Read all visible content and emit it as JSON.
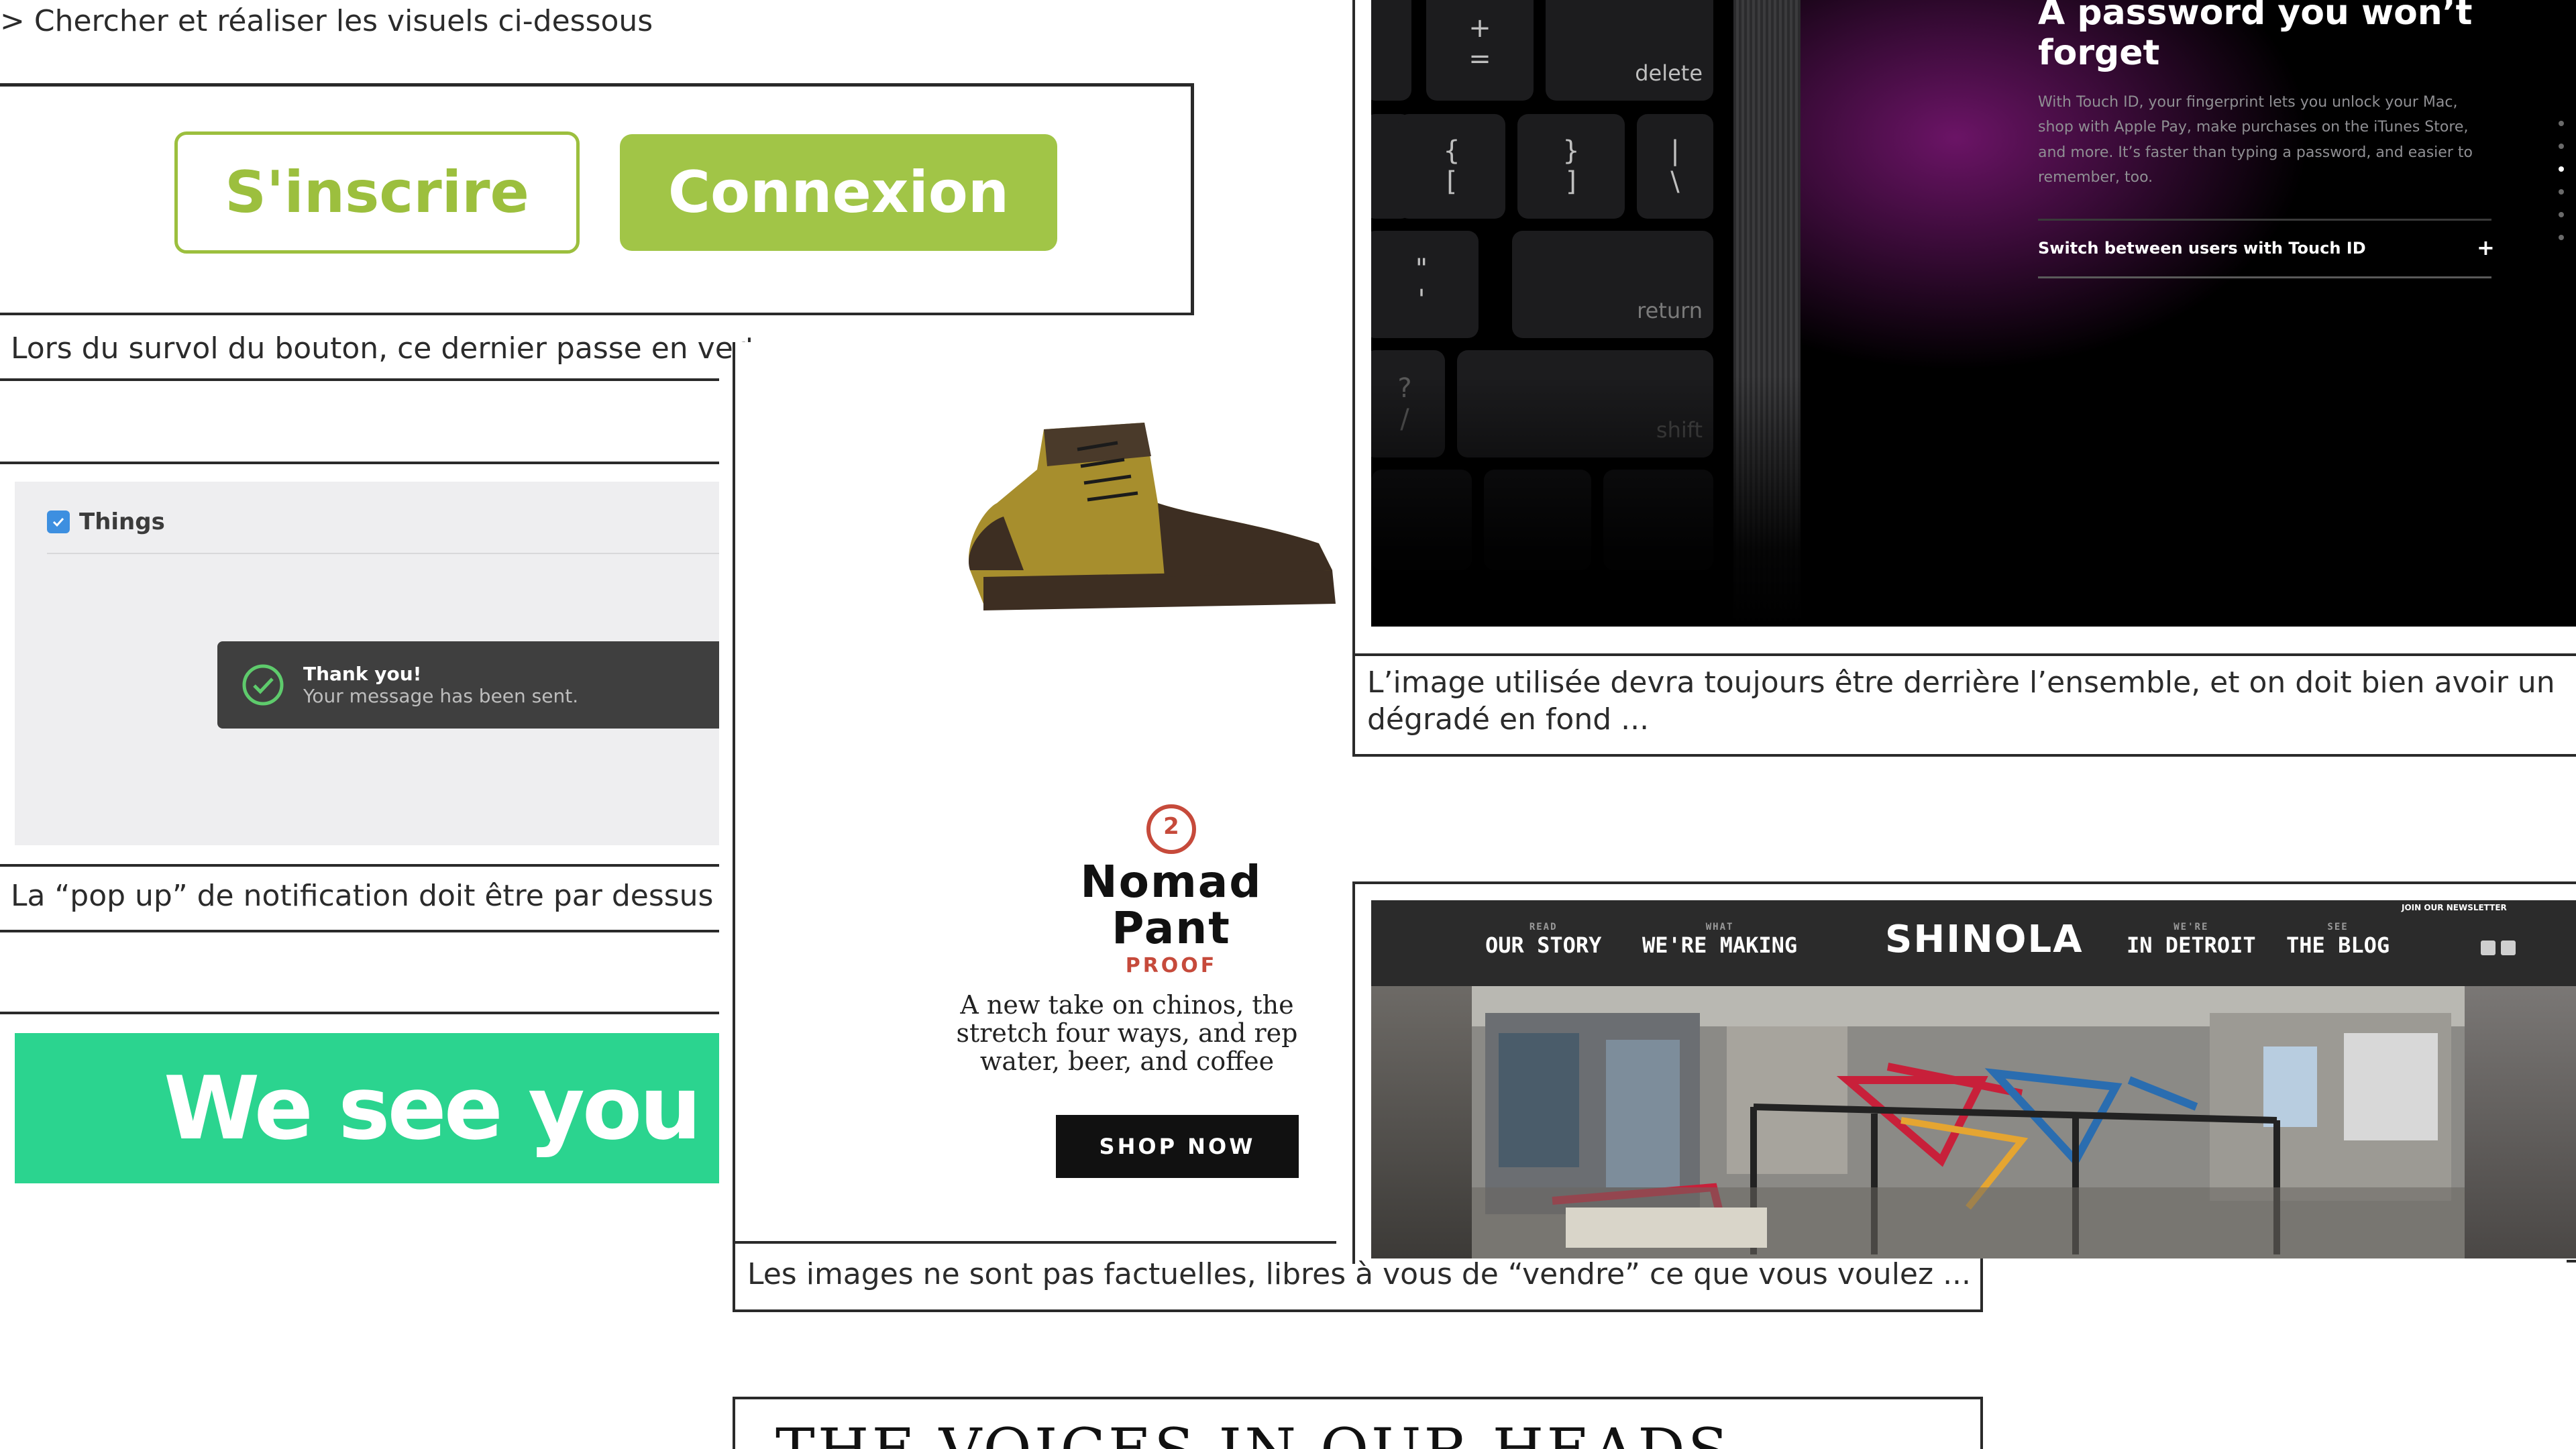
{
  "instruction": "> Chercher et réaliser les visuels ci-dessous",
  "buttons_demo": {
    "signup_label": "S'inscrire",
    "login_label": "Connexion",
    "caption": "Lors du survol du bouton, ce dernier passe en vert."
  },
  "things_demo": {
    "app_name": "Things",
    "toast_title": "Thank you!",
    "toast_message": "Your message has been sent.",
    "caption": "La “pop up” de notification doit être par dessus l’e"
  },
  "green_demo": {
    "text": "We see you th"
  },
  "product_demo": {
    "badge_number": "2",
    "title_line1": "Nomad",
    "title_line2": "Pant",
    "subtitle": "PROOF",
    "desc_line1": "A new take on chinos, the",
    "desc_line2": "stretch four ways, and rep",
    "desc_line3": "water, beer, and coffee",
    "cta": "SHOP NOW",
    "caption": "Les images ne sont pas factuelles, libres à vous de “vendre” ce que vous voulez ..."
  },
  "touchid_demo": {
    "keys": {
      "plus": "+",
      "equals": "=",
      "delete": "delete",
      "brace_open": "{",
      "bracket_open": "[",
      "brace_close": "}",
      "bracket_close": "]",
      "pipe": "|",
      "backslash": "\\",
      "quote": "\"",
      "apostrophe": "'",
      "return": "return",
      "question": "?",
      "slash": "/",
      "shift": "shift"
    },
    "heading_line1": "A password you won’t",
    "heading_line2": "forget",
    "body_line1": "With Touch ID, your fingerprint lets you unlock your Mac,",
    "body_line2": "shop with Apple Pay, make purchases on the iTunes Store,",
    "body_line3": "and more. It’s faster than typing a password, and easier to",
    "body_line4": "remember, too.",
    "link": "Switch between users with Touch ID",
    "link_icon": "+",
    "caption_line1": "L’image utilisée devra toujours être derrière l’ensemble, et on doit bien avoir un",
    "caption_line2": "dégradé en fond ..."
  },
  "shinola_demo": {
    "nav": [
      {
        "small": "READ",
        "label": "OUR STORY"
      },
      {
        "small": "WHAT",
        "label": "WE'RE MAKING"
      },
      {
        "small": "WE'RE",
        "label": "IN DETROIT"
      },
      {
        "small": "SEE",
        "label": "THE BLOG"
      }
    ],
    "logo": "SHINOLA",
    "newsletter": "JOIN OUR NEWSLETTER"
  },
  "voices_demo": {
    "text": "THE VOICES IN OUR HEADS"
  },
  "colors": {
    "green_button": "#a1c547",
    "green_banner": "#2bd48f",
    "accent_red": "#c64a3b",
    "purple_glow": "#6b1466"
  }
}
